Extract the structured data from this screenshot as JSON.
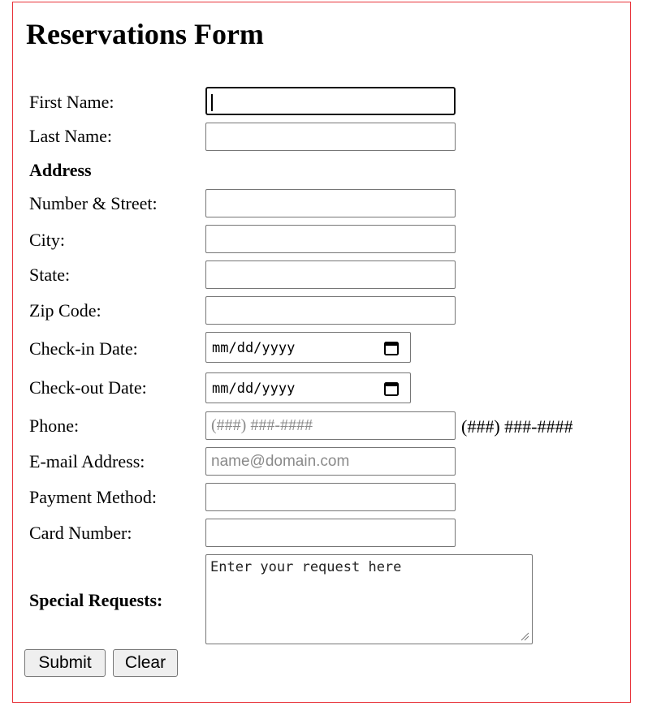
{
  "form": {
    "title": "Reservations Form",
    "fields": {
      "first_name": {
        "label": "First Name:",
        "value": ""
      },
      "last_name": {
        "label": "Last Name:",
        "value": ""
      },
      "address_heading": "Address",
      "street": {
        "label": "Number & Street:",
        "value": ""
      },
      "city": {
        "label": "City:",
        "value": ""
      },
      "state": {
        "label": "State:",
        "value": ""
      },
      "zip": {
        "label": "Zip Code:",
        "value": ""
      },
      "check_in": {
        "label": "Check-in Date:",
        "value_text": "mm/dd/yyyy"
      },
      "check_out": {
        "label": "Check-out Date:",
        "value_text": "mm/dd/yyyy"
      },
      "phone": {
        "label": "Phone:",
        "placeholder": "(###) ###-####",
        "format_hint": "(###) ###-####"
      },
      "email": {
        "label": "E-mail Address:",
        "placeholder": "name@domain.com"
      },
      "payment": {
        "label": "Payment Method:",
        "value": ""
      },
      "card": {
        "label": "Card Number:",
        "value": ""
      },
      "requests": {
        "label": "Special Requests:",
        "placeholder": "Enter your request here"
      }
    },
    "buttons": {
      "submit": "Submit",
      "clear": "Clear"
    }
  },
  "icons": {
    "date_picker": "calendar-icon",
    "textarea_resize": "resize-grip-icon"
  },
  "colors": {
    "frame_border": "#e8333a",
    "field_border": "#767676",
    "focus_border": "#101010",
    "placeholder": "#8a8a8a",
    "button_bg": "#efefef"
  }
}
